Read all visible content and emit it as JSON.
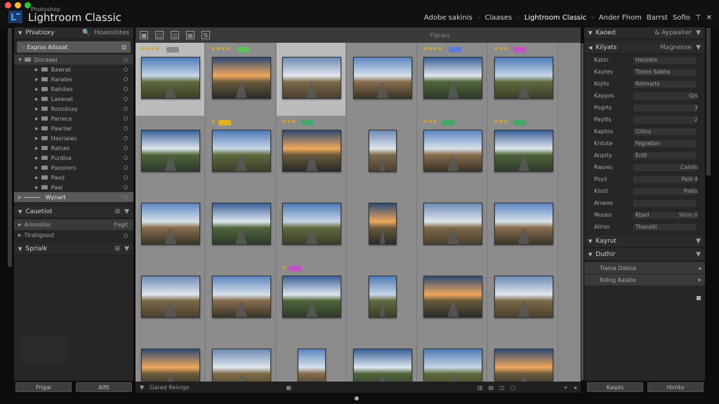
{
  "window": {
    "app_subtitle": "Photoshop",
    "app_name": "Lightroom Classic",
    "modules": [
      "Adobe sakinis",
      "Claases",
      "Lightroom Classic",
      "Ander Fhom",
      "Barrst",
      "Sofio"
    ],
    "active_module": 2,
    "traffic_lights": [
      "#ff5f56",
      "#ffbd2e",
      "#27c93f"
    ]
  },
  "left_panel": {
    "header": "Phiatioxy",
    "header_right": "Hoaoslotes",
    "catalog_label": "Expros Aitosat",
    "folder_root": "Disraael",
    "folders": [
      "Bawrat",
      "Rarates",
      "Rahilies",
      "Lakeoat",
      "Rosnitsay",
      "Parrece",
      "Paarlier",
      "Hasriaies",
      "Ratses",
      "Purdlse",
      "Paosirers",
      "Paod",
      "Paal"
    ],
    "selected_folder": "Wynart",
    "collections_header": "Cauetiot",
    "collections": [
      {
        "label": "Arirnotiss",
        "right": "Fsgit"
      },
      {
        "label": "Tiratigoost",
        "right": ""
      }
    ],
    "publish_header": "Sprialk",
    "btn_left": "Frigal",
    "btn_right": "Alfit"
  },
  "toolbar": {
    "icons": [
      "grid-view-icon",
      "loupe-view-icon",
      "compare-icon",
      "survey-icon",
      "sort-icon"
    ],
    "filter_label": "Flgrass"
  },
  "grid_cells": [
    {
      "row": 0,
      "col": 0,
      "stars": "★★★★",
      "badge": "#8a8a8a",
      "selected": true
    },
    {
      "row": 0,
      "col": 1,
      "stars": "★★★★",
      "badge": "#5fbf5f",
      "selected": false
    },
    {
      "row": 0,
      "col": 2,
      "stars": "",
      "badge": "",
      "selected": true
    },
    {
      "row": 0,
      "col": 3,
      "stars": "",
      "badge": "",
      "selected": false
    },
    {
      "row": 0,
      "col": 4,
      "stars": "★★★★",
      "badge": "#5b7cd6",
      "selected": false
    },
    {
      "row": 0,
      "col": 5,
      "stars": "★★★",
      "badge": "#c552c5",
      "selected": false
    },
    {
      "row": 1,
      "col": 1,
      "stars": "★",
      "badge": "#e0b020",
      "selected": false
    },
    {
      "row": 1,
      "col": 2,
      "stars": "★★★",
      "badge": "#45a86a",
      "selected": false
    },
    {
      "row": 1,
      "col": 4,
      "stars": "★★★",
      "badge": "#45a86a",
      "selected": false
    },
    {
      "row": 1,
      "col": 5,
      "stars": "★★★",
      "badge": "#45a86a",
      "selected": false
    },
    {
      "row": 3,
      "col": 2,
      "stars": "★",
      "badge": "#c552c5",
      "selected": false
    }
  ],
  "right_panel": {
    "header": "Kaoed",
    "header_right": "& Aypaalrer",
    "sub_header": "Kilyats",
    "sub_header_right": "Magnesse",
    "rows": [
      {
        "label": "Katin",
        "value": "Hasinkis",
        "num": ""
      },
      {
        "label": "Kaytes",
        "value": "Tinmo Sabita",
        "num": ""
      },
      {
        "label": "Kojlts",
        "value": "Rotmarts",
        "num": ""
      },
      {
        "label": "Kaypos",
        "value": "",
        "num": "Gis"
      },
      {
        "label": "Pogrts",
        "value": "",
        "num": "3"
      },
      {
        "label": "Paytts",
        "value": "",
        "num": "2"
      },
      {
        "label": "Kaptos",
        "value": "Ciilins",
        "num": ""
      },
      {
        "label": "Kntote",
        "value": "Fegration",
        "num": ""
      },
      {
        "label": "Anpity",
        "value": "Enlit",
        "num": ""
      },
      {
        "label": "Rasres",
        "value": "",
        "num": "Cahilo"
      },
      {
        "label": "Poyli",
        "value": "",
        "num": "Paili 4"
      },
      {
        "label": "Kiiotl",
        "value": "",
        "num": "Pallis"
      },
      {
        "label": "Anwoo",
        "value": "",
        "num": ""
      },
      {
        "label": "Mosko",
        "value": "Kbarl",
        "num": "Shiin 0"
      },
      {
        "label": "Alirso",
        "value": "Tbanoiti",
        "num": ""
      }
    ],
    "section2": "Kayrut",
    "section3": "Duthir",
    "list": [
      "Tiaina Dabiia",
      "Rding Aalate"
    ],
    "btn_left": "Kaipts",
    "btn_right": "Hirnto"
  },
  "bottom": {
    "left_label": "Garad Reivigo"
  }
}
